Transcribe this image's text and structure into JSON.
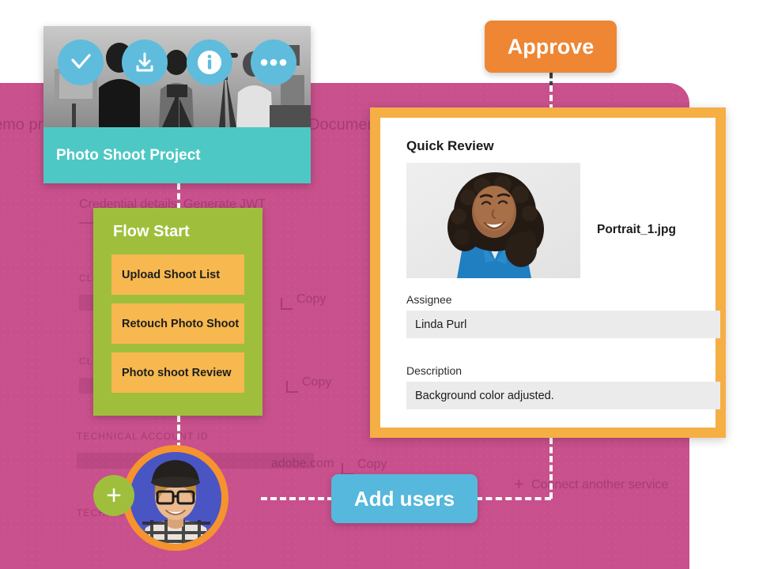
{
  "theme": {
    "pink_panel": "#c8508c",
    "teal": "#4ec8c4",
    "green": "#9fbf3c",
    "task_orange": "#f7b84f",
    "approve_orange": "#ee8634",
    "card_border_orange": "#f5af45",
    "blue_pill": "#55b8dc",
    "icon_blue": "#5fbcdc",
    "avatar_ring": "#f5932f"
  },
  "project_card": {
    "title": "Photo Shoot Project",
    "photo_alt": "photo-shoot-studio",
    "actions": [
      {
        "name": "approve-check-icon",
        "glyph": "check"
      },
      {
        "name": "download-icon",
        "glyph": "download"
      },
      {
        "name": "info-icon",
        "glyph": "info"
      },
      {
        "name": "more-options-icon",
        "glyph": "ellipsis"
      }
    ]
  },
  "flow_card": {
    "title": "Flow Start",
    "tasks": [
      {
        "label": "Upload Shoot List"
      },
      {
        "label": "Retouch Photo Shoot"
      },
      {
        "label": "Photo shoot Review"
      }
    ]
  },
  "review_card": {
    "title": "Quick Review",
    "thumbnail_alt": "portrait-photo",
    "filename": "Portrait_1.jpg",
    "fields": [
      {
        "label": "Assignee",
        "value": "Linda Purl"
      },
      {
        "label": "Description",
        "value": "Background color adjusted."
      }
    ]
  },
  "pills": {
    "approve": "Approve",
    "add_users": "Add users"
  },
  "avatar": {
    "alt": "user-avatar",
    "plus_glyph": "+"
  },
  "background_ui": {
    "demo_project": "emo pro",
    "documentation": "Documentat",
    "credential_details": "Credential details",
    "generate_jwt": "Generate JWT",
    "client_id_1": "CLIENT ID",
    "client_id_2": "CLIENT ID",
    "client_secret": "CLIENT ID",
    "technical_account_id": "TECHNICAL ACCOUNT ID",
    "technical_account_email": "TECHNIC",
    "account_email": "adobe.com",
    "copy_1": "Copy",
    "copy_2": "Copy",
    "copy_3": "Copy",
    "connect_service": "Connect another service",
    "connect_plus": "+"
  }
}
